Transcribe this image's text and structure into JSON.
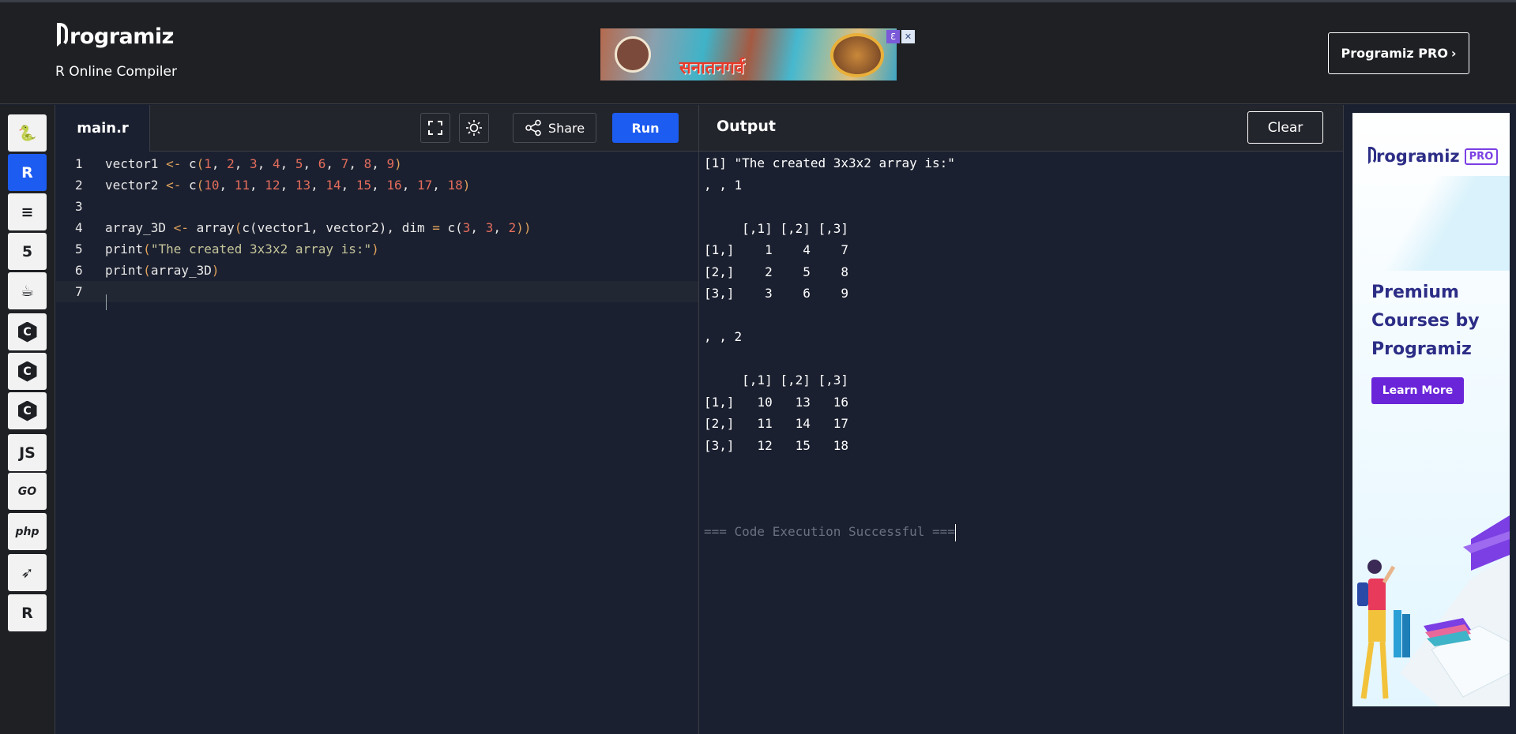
{
  "header": {
    "logo_text": "rogramiz",
    "subtitle": "R Online Compiler",
    "ad_text": "सनातनगर्व",
    "pro_button": "Programiz PRO",
    "pro_chevron": "›"
  },
  "sidebar": {
    "languages": [
      {
        "name": "python",
        "glyph": "🐍",
        "active": false
      },
      {
        "name": "r",
        "glyph": "R",
        "active": true
      },
      {
        "name": "sql",
        "glyph": "≡",
        "active": false
      },
      {
        "name": "html",
        "glyph": "5",
        "active": false
      },
      {
        "name": "java",
        "glyph": "☕",
        "active": false
      },
      {
        "name": "c",
        "glyph": "C",
        "active": false
      },
      {
        "name": "cpp",
        "glyph": "C",
        "active": false
      },
      {
        "name": "csharp",
        "glyph": "C",
        "active": false
      },
      {
        "name": "js",
        "glyph": "JS",
        "active": false
      },
      {
        "name": "go",
        "glyph": "GO",
        "active": false
      },
      {
        "name": "php",
        "glyph": "php",
        "active": false
      },
      {
        "name": "swift",
        "glyph": "➶",
        "active": false
      },
      {
        "name": "rust",
        "glyph": "R",
        "active": false
      }
    ]
  },
  "editor": {
    "tab": "main.r",
    "share_label": "Share",
    "run_label": "Run",
    "lines": [
      [
        {
          "t": "vector1 "
        },
        {
          "t": "<-",
          "c": "op"
        },
        {
          "t": " c"
        },
        {
          "t": "(",
          "c": "paren"
        },
        {
          "t": "1",
          "c": "num"
        },
        {
          "t": ", "
        },
        {
          "t": "2",
          "c": "num"
        },
        {
          "t": ", "
        },
        {
          "t": "3",
          "c": "num"
        },
        {
          "t": ", "
        },
        {
          "t": "4",
          "c": "num"
        },
        {
          "t": ", "
        },
        {
          "t": "5",
          "c": "num"
        },
        {
          "t": ", "
        },
        {
          "t": "6",
          "c": "num"
        },
        {
          "t": ", "
        },
        {
          "t": "7",
          "c": "num"
        },
        {
          "t": ", "
        },
        {
          "t": "8",
          "c": "num"
        },
        {
          "t": ", "
        },
        {
          "t": "9",
          "c": "num"
        },
        {
          "t": ")",
          "c": "paren"
        }
      ],
      [
        {
          "t": "vector2 "
        },
        {
          "t": "<-",
          "c": "op"
        },
        {
          "t": " c"
        },
        {
          "t": "(",
          "c": "paren"
        },
        {
          "t": "10",
          "c": "num"
        },
        {
          "t": ", "
        },
        {
          "t": "11",
          "c": "num"
        },
        {
          "t": ", "
        },
        {
          "t": "12",
          "c": "num"
        },
        {
          "t": ", "
        },
        {
          "t": "13",
          "c": "num"
        },
        {
          "t": ", "
        },
        {
          "t": "14",
          "c": "num"
        },
        {
          "t": ", "
        },
        {
          "t": "15",
          "c": "num"
        },
        {
          "t": ", "
        },
        {
          "t": "16",
          "c": "num"
        },
        {
          "t": ", "
        },
        {
          "t": "17",
          "c": "num"
        },
        {
          "t": ", "
        },
        {
          "t": "18",
          "c": "num"
        },
        {
          "t": ")",
          "c": "paren"
        }
      ],
      [],
      [
        {
          "t": "array_3D "
        },
        {
          "t": "<-",
          "c": "op"
        },
        {
          "t": " array"
        },
        {
          "t": "(",
          "c": "paren"
        },
        {
          "t": "c(vector1, vector2), dim "
        },
        {
          "t": "=",
          "c": "op"
        },
        {
          "t": " c("
        },
        {
          "t": "3",
          "c": "num"
        },
        {
          "t": ", "
        },
        {
          "t": "3",
          "c": "num"
        },
        {
          "t": ", "
        },
        {
          "t": "2",
          "c": "num"
        },
        {
          "t": "))",
          "c": "paren"
        }
      ],
      [
        {
          "t": "print"
        },
        {
          "t": "(",
          "c": "paren"
        },
        {
          "t": "\"The created 3x3x2 array is:\"",
          "c": "str"
        },
        {
          "t": ")",
          "c": "paren"
        }
      ],
      [
        {
          "t": "print"
        },
        {
          "t": "(",
          "c": "paren"
        },
        {
          "t": "array_3D"
        },
        {
          "t": ")",
          "c": "paren"
        }
      ],
      []
    ]
  },
  "output": {
    "title": "Output",
    "clear_label": "Clear",
    "lines": [
      "[1] \"The created 3x3x2 array is:\"",
      ", , 1",
      "",
      "     [,1] [,2] [,3]",
      "[1,]    1    4    7",
      "[2,]    2    5    8",
      "[3,]    3    6    9",
      "",
      ", , 2",
      "",
      "     [,1] [,2] [,3]",
      "[1,]   10   13   16",
      "[2,]   11   14   17",
      "[3,]   12   15   18",
      "",
      ""
    ],
    "status": "=== Code Execution Successful ==="
  },
  "promo": {
    "logo_text": "rogramiz",
    "pro_tag": "PRO",
    "headline": "Premium Courses by Programiz",
    "cta": "Learn More"
  }
}
